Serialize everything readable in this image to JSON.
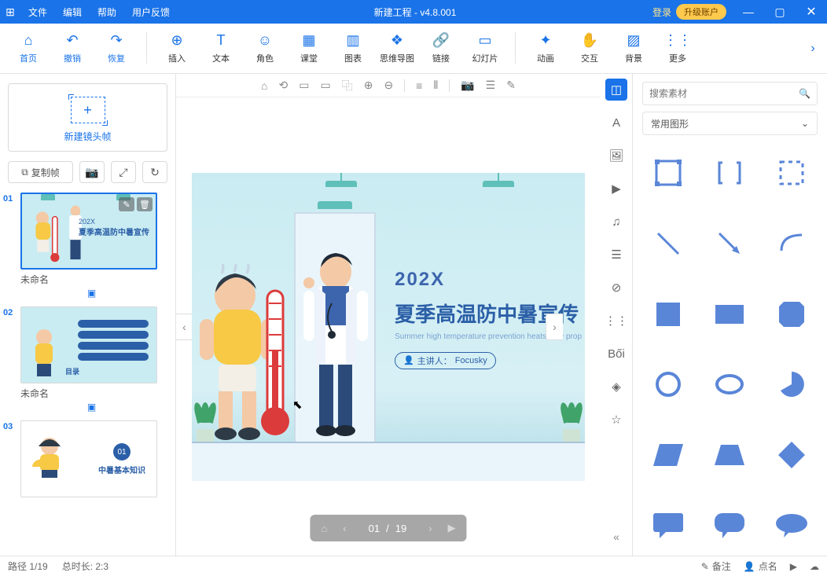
{
  "titlebar": {
    "menu": [
      "文件",
      "编辑",
      "帮助",
      "用户反馈"
    ],
    "title": "新建工程 - v4.8.001",
    "login": "登录",
    "upgrade": "升级账户"
  },
  "ribbon": {
    "items": [
      {
        "icon": "⌂",
        "label": "首页",
        "blue": true
      },
      {
        "icon": "↶",
        "label": "撤销",
        "blue": true
      },
      {
        "icon": "↷",
        "label": "恢复",
        "blue": true
      },
      {
        "sep": true
      },
      {
        "icon": "⊕",
        "label": "插入"
      },
      {
        "icon": "T",
        "label": "文本"
      },
      {
        "icon": "☺",
        "label": "角色"
      },
      {
        "icon": "▦",
        "label": "课堂"
      },
      {
        "icon": "▥",
        "label": "图表"
      },
      {
        "icon": "❖",
        "label": "思维导图"
      },
      {
        "icon": "🔗",
        "label": "链接"
      },
      {
        "icon": "▭",
        "label": "幻灯片"
      },
      {
        "sep": true
      },
      {
        "icon": "✦",
        "label": "动画"
      },
      {
        "icon": "✋",
        "label": "交互"
      },
      {
        "icon": "▨",
        "label": "背景"
      },
      {
        "icon": "⋮⋮",
        "label": "更多"
      }
    ]
  },
  "left": {
    "newframe": "新建镜头帧",
    "copy": "复制帧",
    "slides": [
      {
        "num": "01",
        "name": "未命名",
        "sel": true,
        "overlay": true
      },
      {
        "num": "02",
        "name": "未命名"
      },
      {
        "num": "03",
        "name": ""
      }
    ]
  },
  "canvas": {
    "year": "202X",
    "headline": "夏季高温防中暑宣传",
    "sub": "Summer high temperature prevention heatstroke prop",
    "presenter_label": "主讲人：",
    "presenter_name": "Focusky"
  },
  "canvasbar_icons": [
    "⌂",
    "⟲",
    "▭",
    "▭",
    "⿻",
    "⊕",
    "⊖",
    "|",
    "≡",
    "⫴",
    "|",
    "📷",
    "☰",
    "✎"
  ],
  "pager": {
    "current": "01",
    "total": "19"
  },
  "vtoolbar": [
    "◫",
    "A",
    "🖼",
    "▶",
    "♫",
    "☰",
    "⊘",
    "⋮⋮",
    "Bői",
    "◈",
    "☆"
  ],
  "rightpane": {
    "search_ph": "搜索素材",
    "category": "常用图形"
  },
  "status": {
    "path": "路径 1/19",
    "dur": "总时长: 2:3",
    "remark": "备注",
    "roll": "点名"
  },
  "thumb3_title": "中暑基本知识",
  "thumb3_num": "01"
}
